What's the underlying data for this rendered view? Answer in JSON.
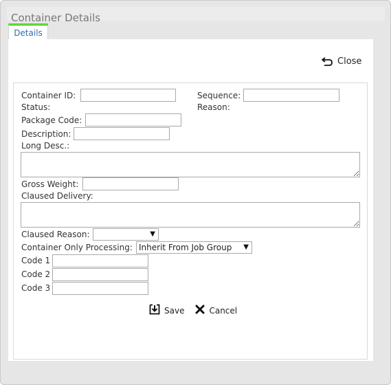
{
  "window": {
    "title": "Container Details",
    "tab_label": "Details",
    "close_label": "Close"
  },
  "form": {
    "container_id_label": "Container ID:",
    "container_id_value": "",
    "sequence_label": "Sequence:",
    "sequence_value": "",
    "status_label": "Status:",
    "reason_label": "Reason:",
    "package_code_label": "Package Code:",
    "package_code_value": "",
    "description_label": "Description:",
    "description_value": "",
    "long_desc_label": "Long Desc.:",
    "long_desc_value": "",
    "gross_weight_label": "Gross Weight:",
    "gross_weight_value": "",
    "claused_delivery_label": "Claused Delivery:",
    "claused_delivery_value": "",
    "claused_reason_label": "Claused Reason:",
    "claused_reason_value": "",
    "container_only_processing_label": "Container Only Processing:",
    "container_only_processing_value": "Inherit From Job Group",
    "code1_label": "Code 1",
    "code1_value": "",
    "code2_label": "Code 2",
    "code2_value": "",
    "code3_label": "Code 3",
    "code3_value": ""
  },
  "actions": {
    "save_label": "Save",
    "cancel_label": "Cancel"
  },
  "colors": {
    "accent_underline": "#5fd63a",
    "tab_text": "#2e6ea6"
  }
}
